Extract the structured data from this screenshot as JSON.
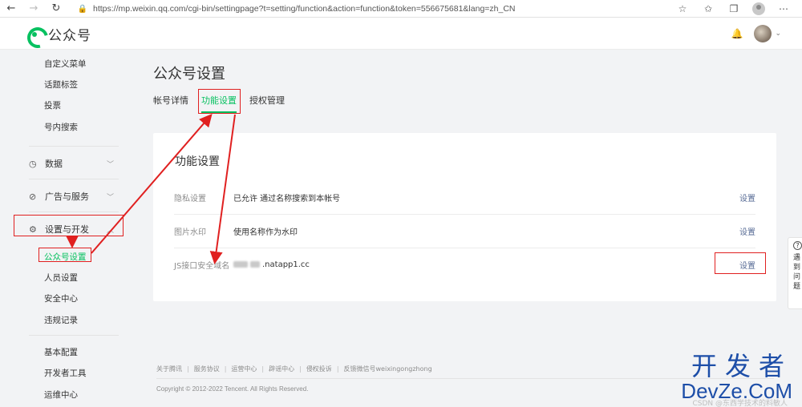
{
  "browser": {
    "url": "https://mp.weixin.qq.com/cgi-bin/settingpage?t=setting/function&action=function&token=556675681&lang=zh_CN"
  },
  "header": {
    "brand": "公众号"
  },
  "sidebar": {
    "top_items": [
      "自定义菜单",
      "话题标签",
      "投票",
      "号内搜索"
    ],
    "groups": [
      {
        "label": "数据",
        "icon": "chart-icon"
      },
      {
        "label": "广告与服务",
        "icon": "compass-icon"
      },
      {
        "label": "设置与开发",
        "icon": "gear-icon"
      }
    ],
    "settings_items": [
      "公众号设置",
      "人员设置",
      "安全中心",
      "违规记录"
    ],
    "bottom_items": [
      "基本配置",
      "开发者工具",
      "运维中心"
    ]
  },
  "main": {
    "title": "公众号设置",
    "tabs": [
      "帐号详情",
      "功能设置",
      "授权管理"
    ],
    "active_tab": "功能设置",
    "card_title": "功能设置",
    "rows": [
      {
        "label": "隐私设置",
        "value": "已允许 通过名称搜索到本帐号",
        "action": "设置"
      },
      {
        "label": "图片水印",
        "value": "使用名称作为水印",
        "action": "设置"
      },
      {
        "label": "JS接口安全域名",
        "value": ".natapp1.cc",
        "action": "设置"
      }
    ]
  },
  "footer": {
    "links": [
      "关于腾讯",
      "服务协议",
      "运营中心",
      "辟谣中心",
      "侵权投诉",
      "反馈微信号weixingongzhong"
    ],
    "copyright": "Copyright © 2012-2022 Tencent. All Rights Reserved."
  },
  "help_float": {
    "text": [
      "遇",
      "到",
      "问",
      "题"
    ]
  },
  "watermark": {
    "cn": "开发者",
    "en": "DevZe.CoM",
    "csdn": "CSDN @东西学技术的料敏人"
  },
  "colors": {
    "accent": "#07c160",
    "link": "#576b95",
    "annotation": "#e02020"
  }
}
